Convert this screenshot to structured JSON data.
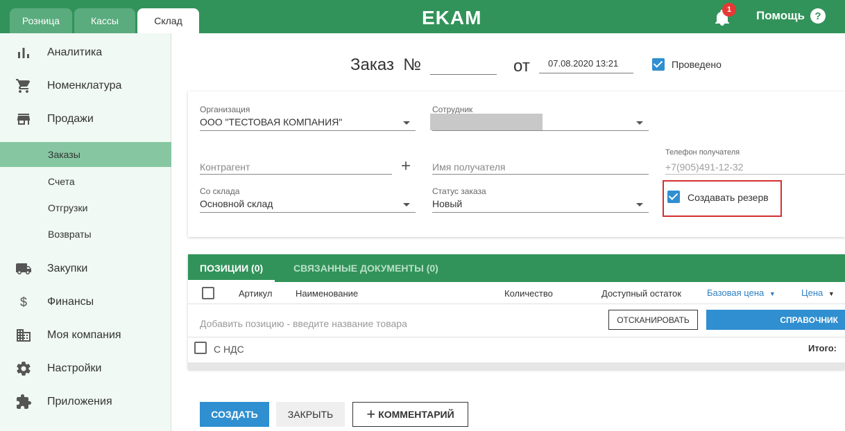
{
  "topbar": {
    "tabs": [
      "Розница",
      "Кассы",
      "Склад"
    ],
    "logo": "EKAM",
    "notifications": "1",
    "help": "Помощь"
  },
  "sidebar": {
    "items": [
      {
        "label": "Аналитика",
        "icon": "bar-chart-icon"
      },
      {
        "label": "Номенклатура",
        "icon": "cart-icon"
      },
      {
        "label": "Продажи",
        "icon": "store-icon"
      },
      {
        "label": "Закупки",
        "icon": "truck-icon"
      },
      {
        "label": "Финансы",
        "icon": "dollar-icon"
      },
      {
        "label": "Моя компания",
        "icon": "building-icon"
      },
      {
        "label": "Настройки",
        "icon": "gear-icon"
      },
      {
        "label": "Приложения",
        "icon": "puzzle-icon"
      }
    ],
    "sub_items": [
      "Заказы",
      "Счета",
      "Отгрузки",
      "Возвраты"
    ]
  },
  "order": {
    "title": "Заказ  №",
    "from": "от",
    "date": "07.08.2020 13:21",
    "posted_label": "Проведено"
  },
  "form": {
    "org_label": "Организация",
    "org_value": "ООО \"ТЕСТОВАЯ КОМПАНИЯ\"",
    "employee_label": "Сотрудник",
    "counterparty_placeholder": "Контрагент",
    "recipient_placeholder": "Имя получателя",
    "phone_label": "Телефон получателя",
    "phone_placeholder": "+7(905)491-12-32",
    "warehouse_label": "Со склада",
    "warehouse_value": "Основной склад",
    "status_label": "Статус заказа",
    "status_value": "Новый",
    "reserve_label": "Создавать резерв"
  },
  "positions": {
    "tab_positions": "ПОЗИЦИИ (0)",
    "tab_docs": "СВЯЗАННЫЕ ДОКУМЕНТЫ (0)",
    "col_article": "Артикул",
    "col_name": "Наименование",
    "col_qty": "Количество",
    "col_stock": "Доступный остаток",
    "col_base_price": "Базовая цена",
    "col_price": "Цена",
    "add_placeholder": "Добавить позицию - введите название товара",
    "scan_label": "ОТСКАНИРОВАТЬ",
    "catalog_label": "СПРАВОЧНИК",
    "vat_label": "С НДС",
    "total_label": "Итого:"
  },
  "actions": {
    "create": "СОЗДАТЬ",
    "close": "ЗАКРЫТЬ",
    "comment": "КОММЕНТАРИЙ"
  },
  "colors": {
    "brand_green": "#32935a",
    "accent_blue": "#2f8fd0",
    "alert_red": "#d32f2f"
  }
}
